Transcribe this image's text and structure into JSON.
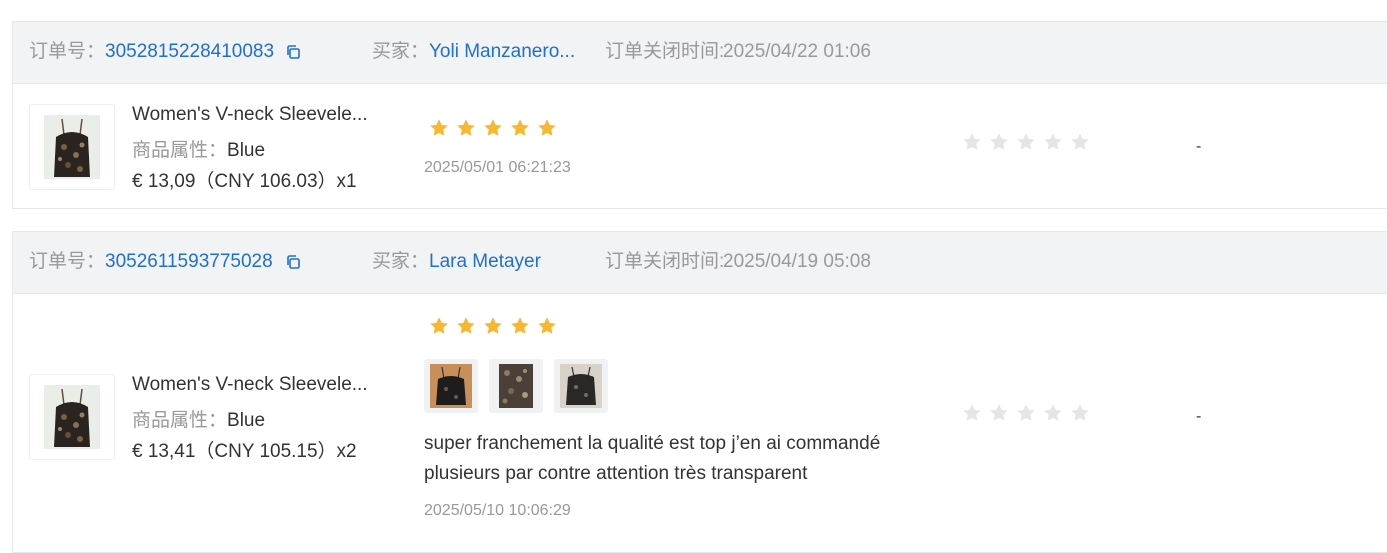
{
  "labels": {
    "order_no": "订单号：",
    "buyer": "买家：",
    "close_time": "订单关闭时间:",
    "attr": "商品属性："
  },
  "orders": [
    {
      "order_no": "3052815228410083",
      "buyer": "Yoli Manzanero...",
      "close_time": "2025/04/22 01:06",
      "product_title": "Women's V-neck Sleevele...",
      "attr_value": "Blue",
      "price": "€ 13,09（CNY  106.03）x1",
      "rating": 5,
      "review_time": "2025/05/01 06:21:23",
      "reply_rating": 0,
      "reply": "-"
    },
    {
      "order_no": "3052611593775028",
      "buyer": "Lara Metayer",
      "close_time": "2025/04/19 05:08",
      "product_title": "Women's V-neck Sleevele...",
      "attr_value": "Blue",
      "price": "€ 13,41（CNY  105.15）x2",
      "rating": 5,
      "review_text": "super franchement la qualité est top j’en ai commandé plusieurs par contre attention très transparent",
      "review_time": "2025/05/10 10:06:29",
      "reply_rating": 0,
      "reply": "-"
    }
  ],
  "colors": {
    "link": "#1f6fd1",
    "star_on": "#f7b731",
    "star_off": "#e5e5e5",
    "header_bg": "#f2f3f5"
  },
  "icons": {
    "copy": "copy-icon",
    "star": "star-icon",
    "product": "product-image"
  }
}
